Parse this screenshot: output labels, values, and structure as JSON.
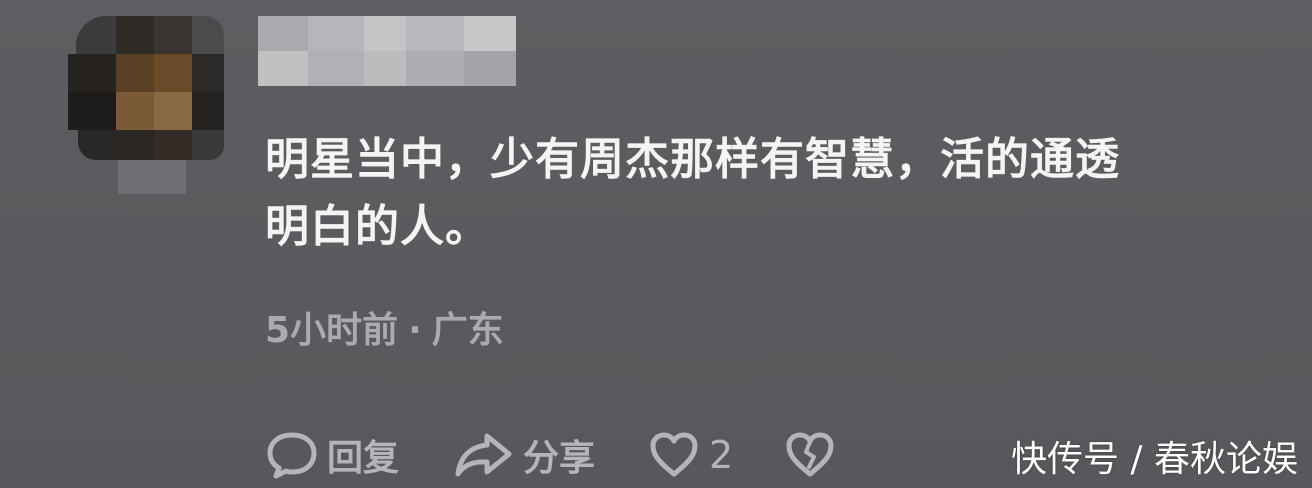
{
  "comment": {
    "line1": "明星当中，少有周杰那样有智慧，活的通透",
    "line2": "明白的人。",
    "time": "5小时前",
    "separator": "·",
    "location": "广东"
  },
  "actions": {
    "reply_label": "回复",
    "share_label": "分享",
    "like_count": "2"
  },
  "watermark": "快传号 / 春秋论娱",
  "colors": {
    "background": "#595b5e",
    "comment_text": "#f4f4f4",
    "meta_text": "#a9abae",
    "action_text": "#b3b5b8"
  },
  "icons": {
    "reply": "speech-bubble-icon",
    "share": "share-arrow-icon",
    "like": "heart-icon",
    "dislike": "broken-heart-icon"
  }
}
